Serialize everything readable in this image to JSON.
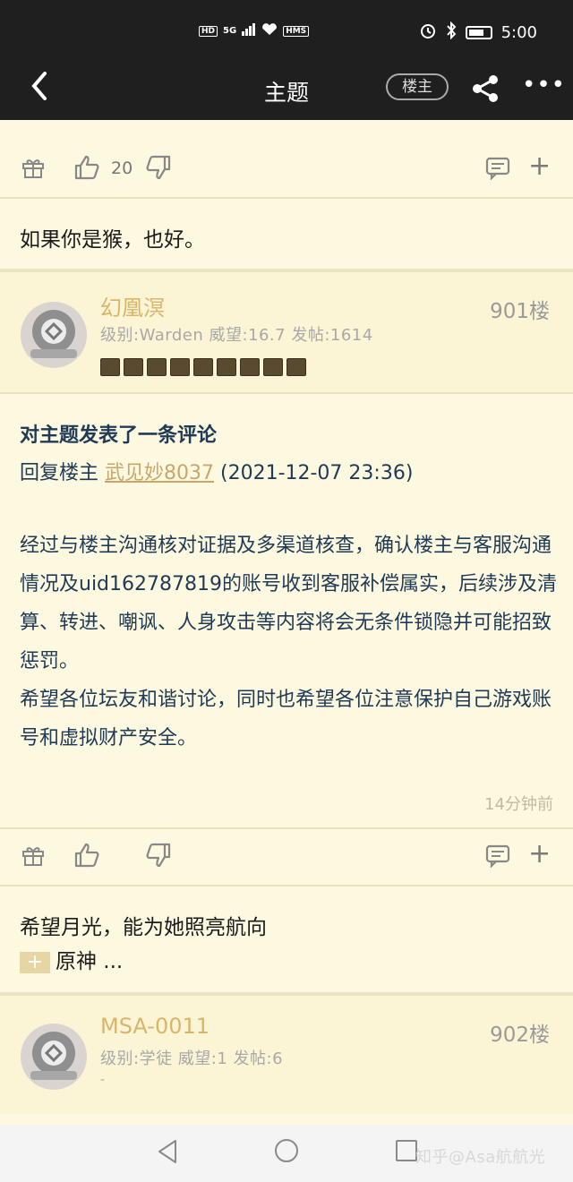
{
  "status_bar": {
    "left_chips": [
      "HD",
      "5G",
      "HMS"
    ],
    "time": "5:00",
    "icons": [
      "signal-icon",
      "heart-icon",
      "alarm-icon",
      "bluetooth-icon",
      "battery-icon"
    ]
  },
  "header": {
    "back_icon": "chevron-left-icon",
    "title": "主题",
    "lz_button": "楼主",
    "share_icon": "share-icon",
    "more_icon": "more-icon"
  },
  "post_prev": {
    "likes": "20",
    "quote": "如果你是猴，也好。"
  },
  "post_901": {
    "username": "幻凰溟",
    "meta": "级别:Warden 威望:16.7 发帖:1614",
    "floor": "901楼",
    "badge_count": 9,
    "body_title": "对主题发表了一条评论",
    "reply_prefix": "回复楼主 ",
    "reply_user": "武见妙8037",
    "reply_time": " (2021-12-07 23:36)",
    "body": "经过与楼主沟通核对证据及多渠道核查，确认楼主与客服沟通情况及uid162787819的账号收到客服补偿属实，后续涉及清算、转进、嘲讽、人身攻击等内容将会无条件锁隐并可能招致惩罚。\n希望各位坛友和谐讨论，同时也希望各位注意保护自己游戏账号和虚拟财产安全。",
    "time_ago": "14分钟前",
    "quote": "希望月光，能为她照亮航向",
    "tag_plus": "+",
    "tag_text": "原神 ..."
  },
  "post_902": {
    "username": "MSA-0011",
    "meta": "级别:学徒 威望:1 发帖:6",
    "floor": "902楼",
    "extra": "-"
  },
  "bottom_nav": {
    "watermark": "知乎@Asa航航光"
  },
  "colors": {
    "page_bg": "#fdf8e0",
    "header_bg": "#1f1f1f",
    "username": "#d9b56a",
    "body_text": "#1f3a57"
  }
}
